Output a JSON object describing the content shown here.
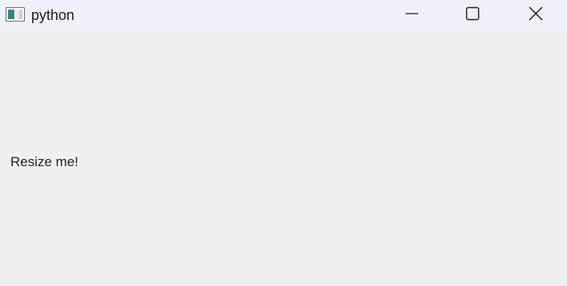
{
  "window": {
    "title": "python",
    "controls": {
      "minimize": "minimize-icon",
      "maximize": "maximize-icon",
      "close": "close-icon"
    }
  },
  "content": {
    "label": "Resize me!"
  },
  "colors": {
    "titlebar_bg": "#eff1f8",
    "client_bg": "#f0f0f0",
    "text": "#1b1b1b"
  }
}
